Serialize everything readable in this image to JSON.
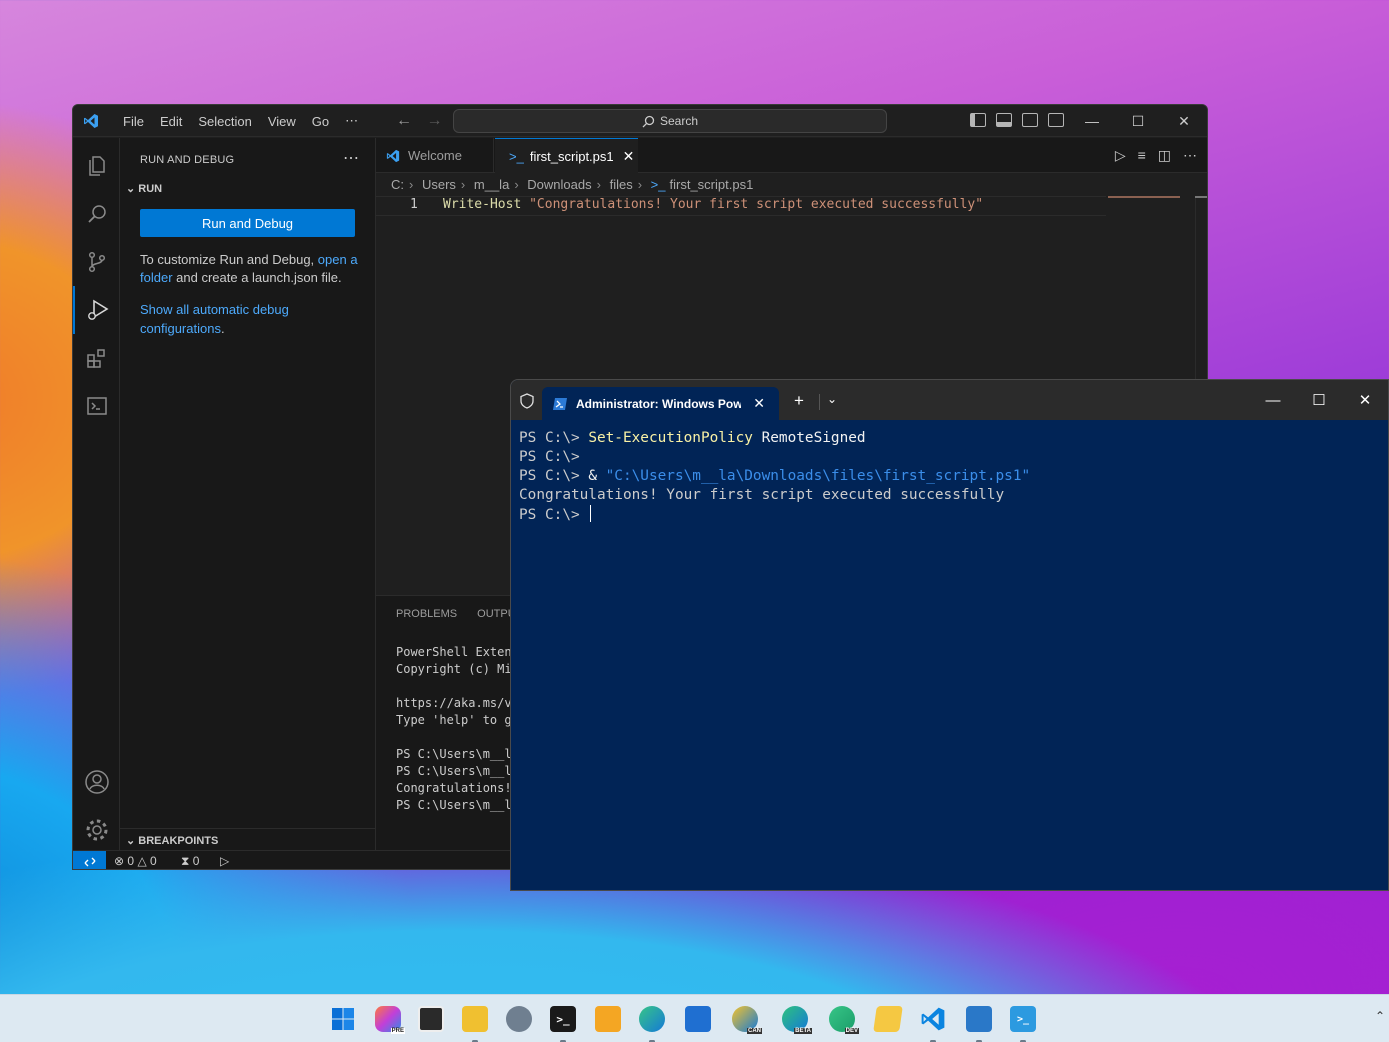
{
  "vscode": {
    "menu": [
      "File",
      "Edit",
      "Selection",
      "View",
      "Go",
      "⋯"
    ],
    "search_placeholder": "Search",
    "sidebar": {
      "title": "RUN AND DEBUG",
      "section": "RUN",
      "run_button": "Run and Debug",
      "customize_text_before": "To customize Run and Debug, ",
      "customize_link": "open a folder",
      "customize_text_after": " and create a launch.json file.",
      "show_all_link": "Show all automatic debug configurations",
      "show_all_period": ".",
      "breakpoints": "BREAKPOINTS"
    },
    "tabs": [
      {
        "label": "Welcome"
      },
      {
        "label": "first_script.ps1"
      }
    ],
    "breadcrumb": [
      "C:",
      "Users",
      "m__la",
      "Downloads",
      "files",
      "first_script.ps1"
    ],
    "editor": {
      "line_number": "1",
      "keyword": "Write-Host",
      "string": "\"Congratulations! Your first script executed successfully\""
    },
    "panel": {
      "tabs": [
        "PROBLEMS",
        "OUTPUT"
      ],
      "lines": [
        "PowerShell Extens",
        "Copyright (c) Mic",
        "",
        "https://aka.ms/vs",
        "Type 'help' to ge",
        "",
        "PS C:\\Users\\m__la",
        "PS C:\\Users\\m__la",
        "Congratulations!",
        "PS C:\\Users\\m__la"
      ]
    },
    "status": {
      "errors": "0",
      "warnings": "0",
      "ports": "0"
    }
  },
  "terminal": {
    "tab_title": "Administrator: Windows PowerShell",
    "lines": [
      {
        "prompt": "PS C:\\> ",
        "cmd": "Set-ExecutionPolicy",
        "args": " RemoteSigned"
      },
      {
        "prompt": "PS C:\\>",
        "cmd": "",
        "args": ""
      },
      {
        "prompt": "PS C:\\> ",
        "cmd": "& ",
        "path": "\"C:\\Users\\m__la\\Downloads\\files\\first_script.ps1\""
      },
      {
        "output": "Congratulations! Your first script executed successfully"
      },
      {
        "prompt": "PS C:\\> "
      }
    ]
  },
  "taskbar": {
    "badges": [
      "PRE",
      "CAN",
      "BETA",
      "DEV"
    ],
    "colors": {
      "start": "#0078d4",
      "explorer": "#f0c030",
      "vscode": "#0078d4"
    }
  }
}
